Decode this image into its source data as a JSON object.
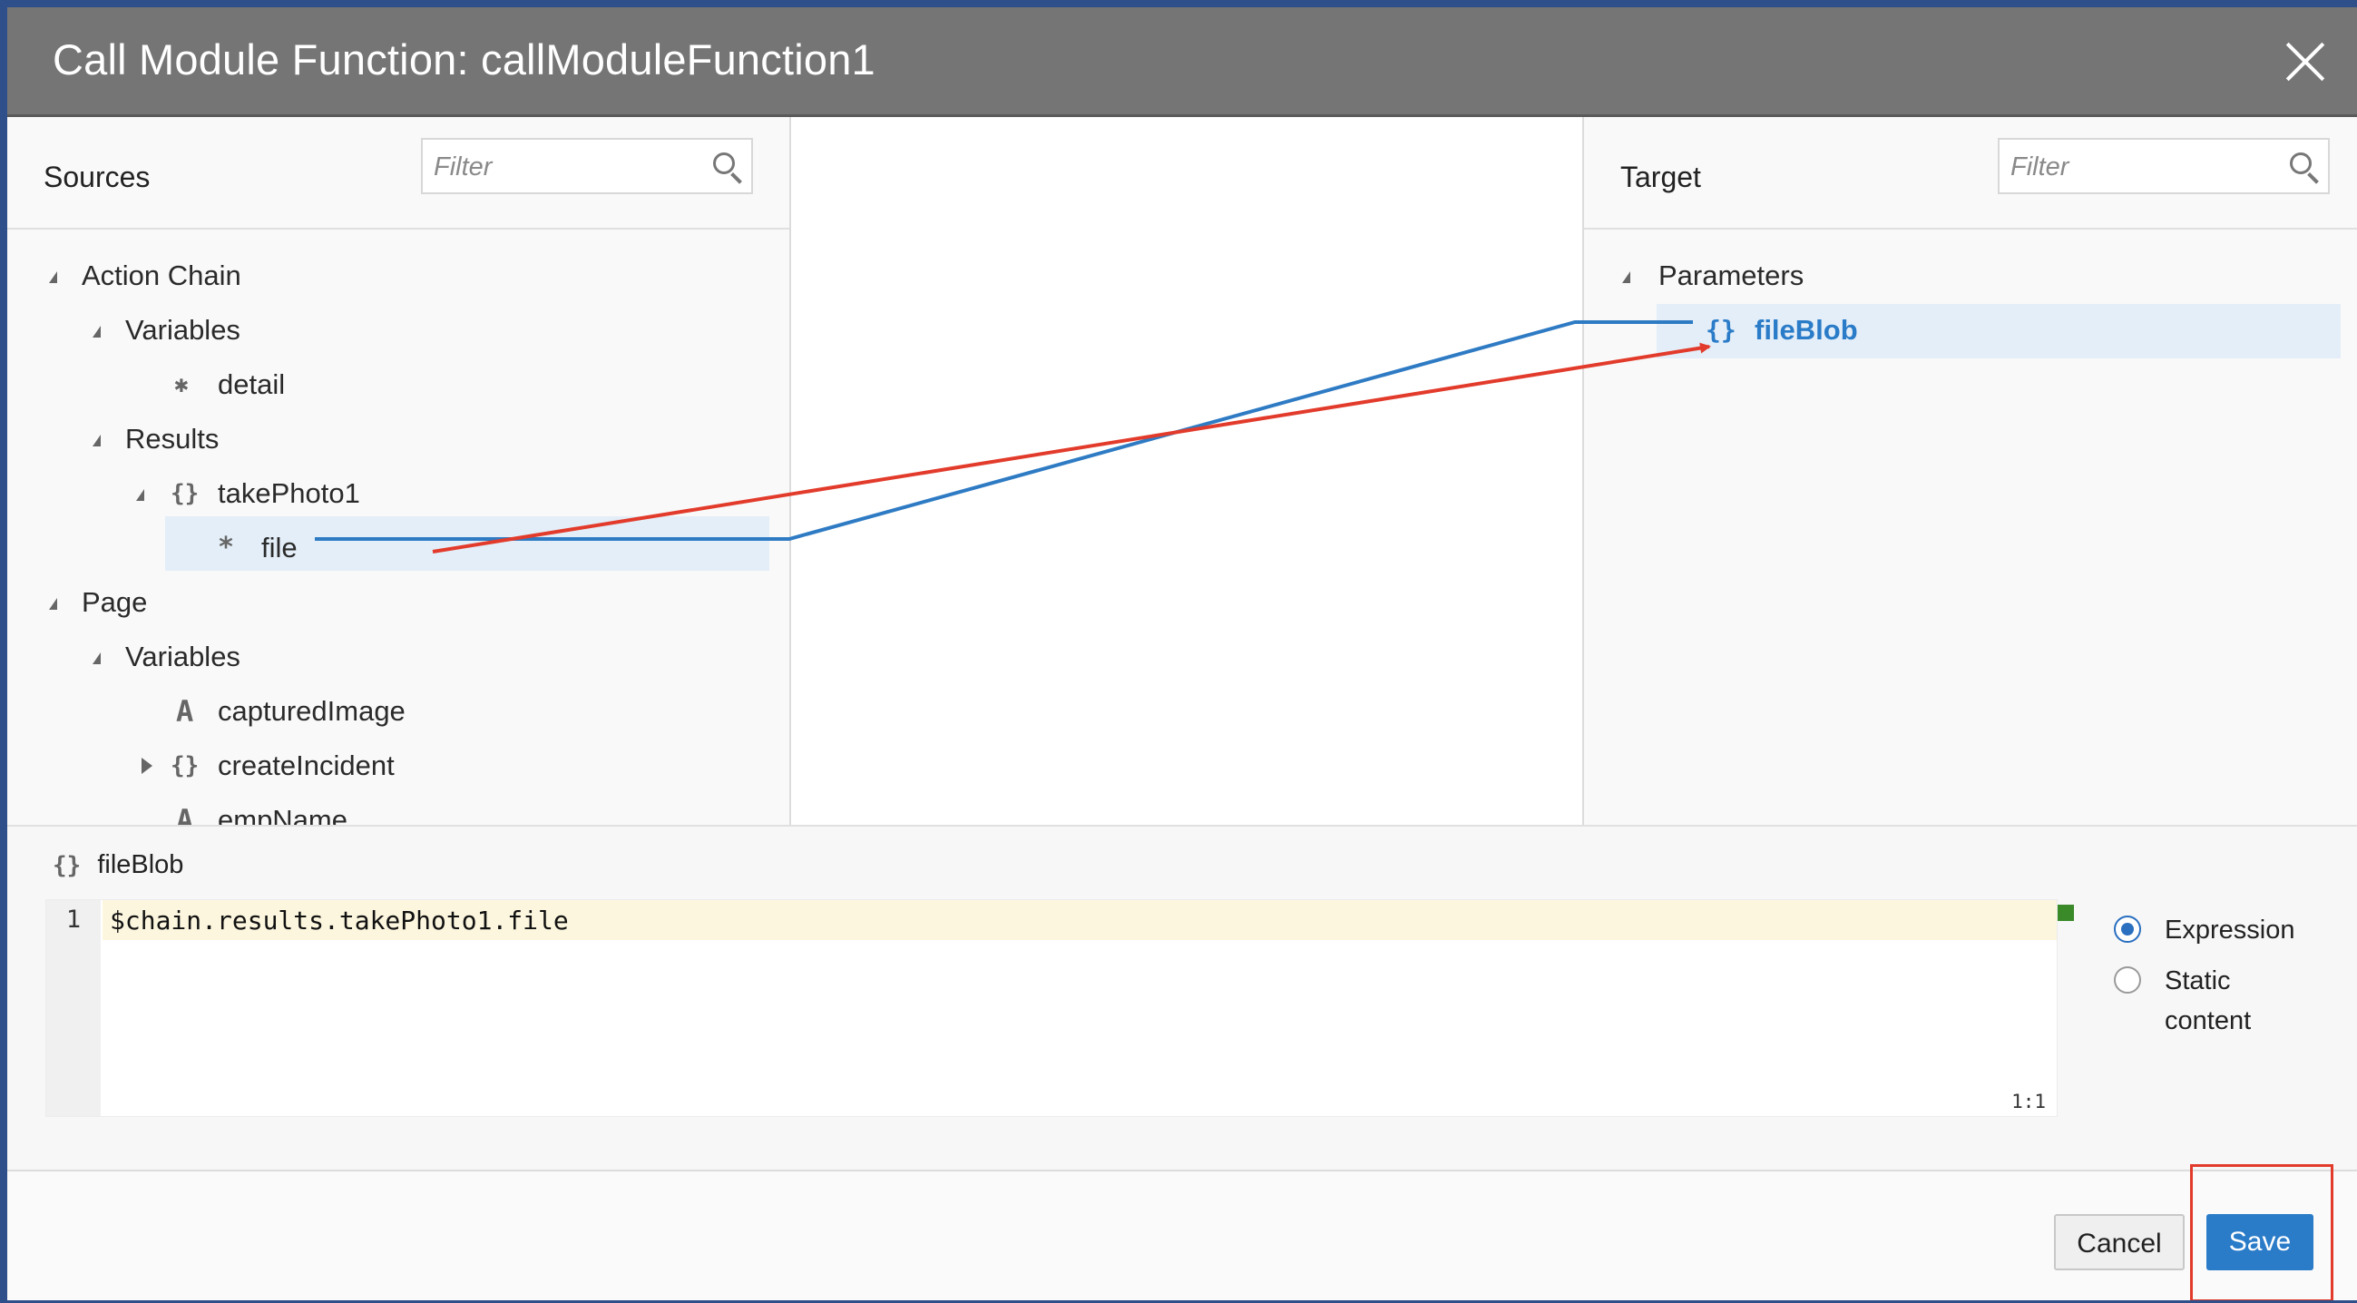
{
  "dialog": {
    "title": "Call Module Function: callModuleFunction1",
    "close_icon": "close-icon"
  },
  "sources": {
    "title": "Sources",
    "filter_placeholder": "Filter",
    "tree": {
      "action_chain": "Action Chain",
      "variables": "Variables",
      "detail": "detail",
      "results": "Results",
      "take_photo": "takePhoto1",
      "file": "file",
      "page": "Page",
      "page_variables": "Variables",
      "captured_image": "capturedImage",
      "create_incident": "createIncident",
      "emp_name": "empName"
    }
  },
  "target": {
    "title": "Target",
    "filter_placeholder": "Filter",
    "tree": {
      "parameters": "Parameters",
      "file_blob": "fileBlob"
    }
  },
  "mapping": {
    "line_color": "#2e7bc4",
    "arrow_color": "#e23b2b"
  },
  "expression": {
    "selected_name": "fileBlob",
    "line_number": "1",
    "code": "$chain.results.takePhoto1.file",
    "cursor_pos": "1:1",
    "status_color": "#3a8a2a",
    "mode_expression": "Expression",
    "mode_static": "Static content",
    "selected_mode": "Expression"
  },
  "footer": {
    "cancel_label": "Cancel",
    "save_label": "Save",
    "highlight_color": "#e23b2b",
    "accent_color": "#2a7bc8"
  }
}
